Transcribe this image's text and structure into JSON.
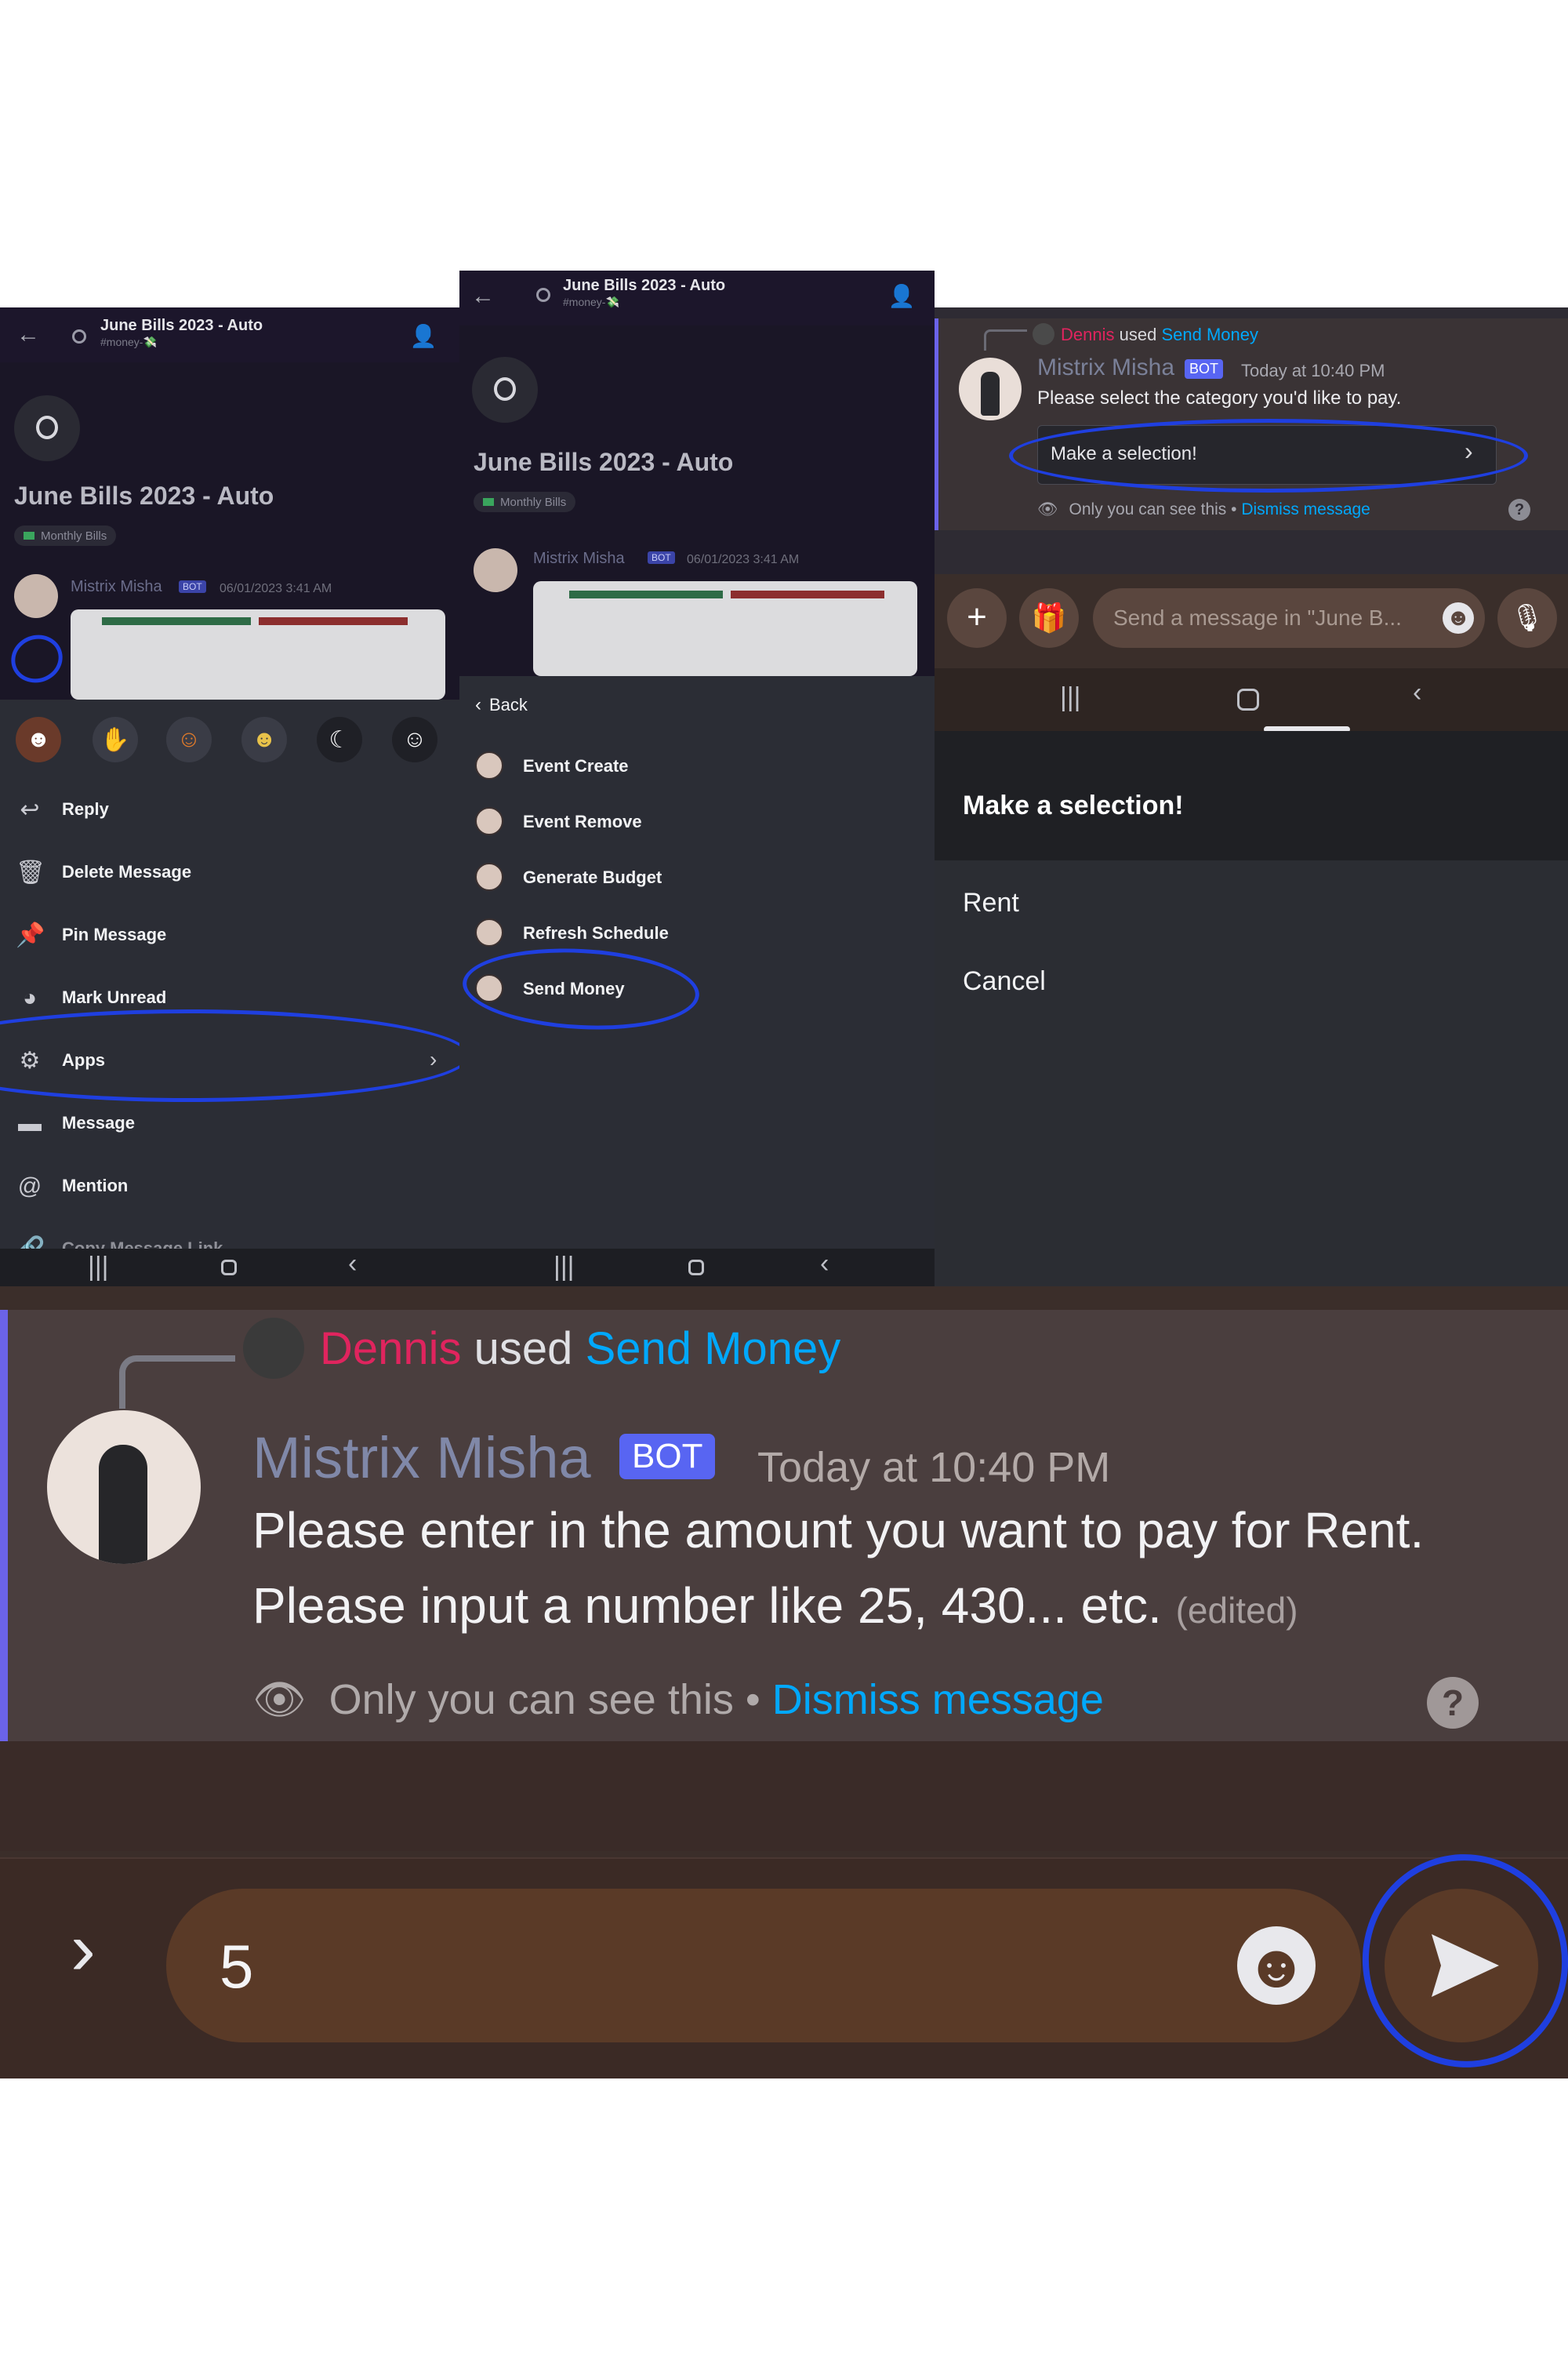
{
  "panel1": {
    "thread_title": "June Bills 2023 - Auto",
    "thread_channel": "#money-💸",
    "thread_heading": "June Bills 2023 - Auto",
    "tag": "Monthly Bills",
    "bot_name": "Mistrix Misha",
    "bot_badge": "BOT",
    "timestamp": "06/01/2023 3:41 AM",
    "emojis": [
      "emoji-1",
      "emoji-2",
      "emoji-3",
      "emoji-4",
      "emoji-5",
      "emoji-6"
    ],
    "menu": [
      {
        "label": "Reply",
        "icon": "reply-icon"
      },
      {
        "label": "Delete Message",
        "icon": "trash-icon"
      },
      {
        "label": "Pin Message",
        "icon": "pin-icon"
      },
      {
        "label": "Mark Unread",
        "icon": "mark-unread-icon"
      },
      {
        "label": "Apps",
        "icon": "apps-icon"
      },
      {
        "label": "Message",
        "icon": "message-icon"
      },
      {
        "label": "Mention",
        "icon": "at-icon"
      },
      {
        "label": "Copy Message Link",
        "icon": "link-icon"
      }
    ]
  },
  "panel2": {
    "thread_title": "June Bills 2023 - Auto",
    "thread_channel": "#money-💸",
    "thread_heading": "June Bills 2023 - Auto",
    "tag": "Monthly Bills",
    "bot_name": "Mistrix Misha",
    "bot_badge": "BOT",
    "timestamp": "06/01/2023 3:41 AM",
    "back_label": "Back",
    "apps": [
      "Event Create",
      "Event Remove",
      "Generate Budget",
      "Refresh Schedule",
      "Send Money"
    ]
  },
  "panel3": {
    "user": "Dennis",
    "used": "used",
    "command": "Send Money",
    "bot_name": "Mistrix Misha",
    "bot_badge": "BOT",
    "timestamp": "Today at 10:40 PM",
    "message": "Please select the category you'd like to pay.",
    "select_placeholder": "Make a selection!",
    "ephemeral": "Only you can see this •",
    "dismiss": "Dismiss message",
    "input_placeholder": "Send a message in \"June B...",
    "sheet_title": "Make a selection!",
    "options": [
      "Rent",
      "Cancel"
    ]
  },
  "panel4": {
    "user": "Dennis",
    "used": "used",
    "command": "Send Money",
    "bot_name": "Mistrix Misha",
    "bot_badge": "BOT",
    "timestamp": "Today at 10:40 PM",
    "line1": "Please enter in the amount you want to pay for Rent.",
    "line2": "Please input a number like 25, 430... etc.",
    "edited": "(edited)",
    "ephemeral": "Only you can see this •",
    "dismiss": "Dismiss message",
    "input_value": "5"
  },
  "colors": {
    "annotation": "#1f3fe0",
    "link": "#00a8fc",
    "dennis": "#e0245e",
    "bot_badge": "#5865f2"
  }
}
